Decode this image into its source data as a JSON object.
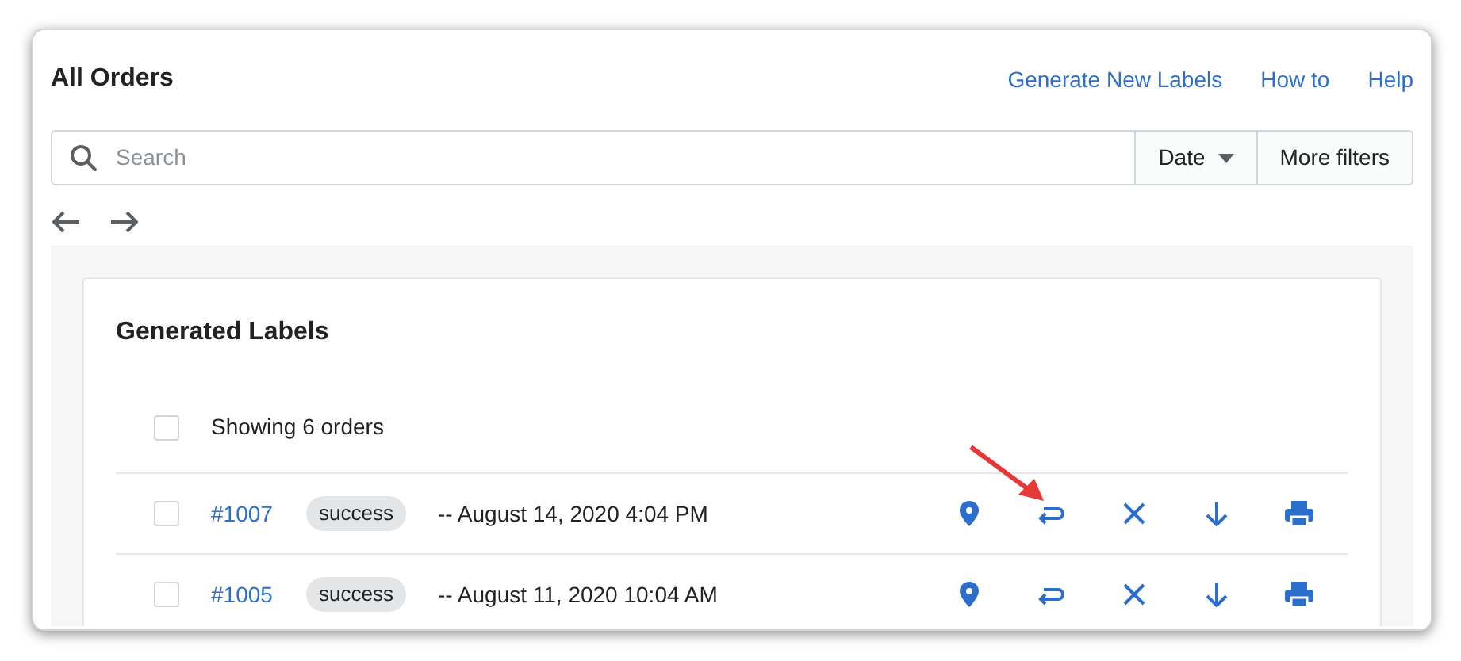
{
  "header": {
    "title": "All Orders",
    "links": [
      "Generate New Labels",
      "How to",
      "Help"
    ]
  },
  "filters": {
    "search_placeholder": "Search",
    "date_label": "Date",
    "more_filters": "More filters"
  },
  "card": {
    "title": "Generated Labels",
    "select_all": {
      "checked": false,
      "label": "Showing 6 orders"
    },
    "rows": [
      {
        "checked": false,
        "order": "#1007",
        "status": "success",
        "date": "-- August 14, 2020 4:04 PM"
      },
      {
        "checked": false,
        "order": "#1005",
        "status": "success",
        "date": "-- August 11, 2020 10:04 AM"
      }
    ]
  }
}
